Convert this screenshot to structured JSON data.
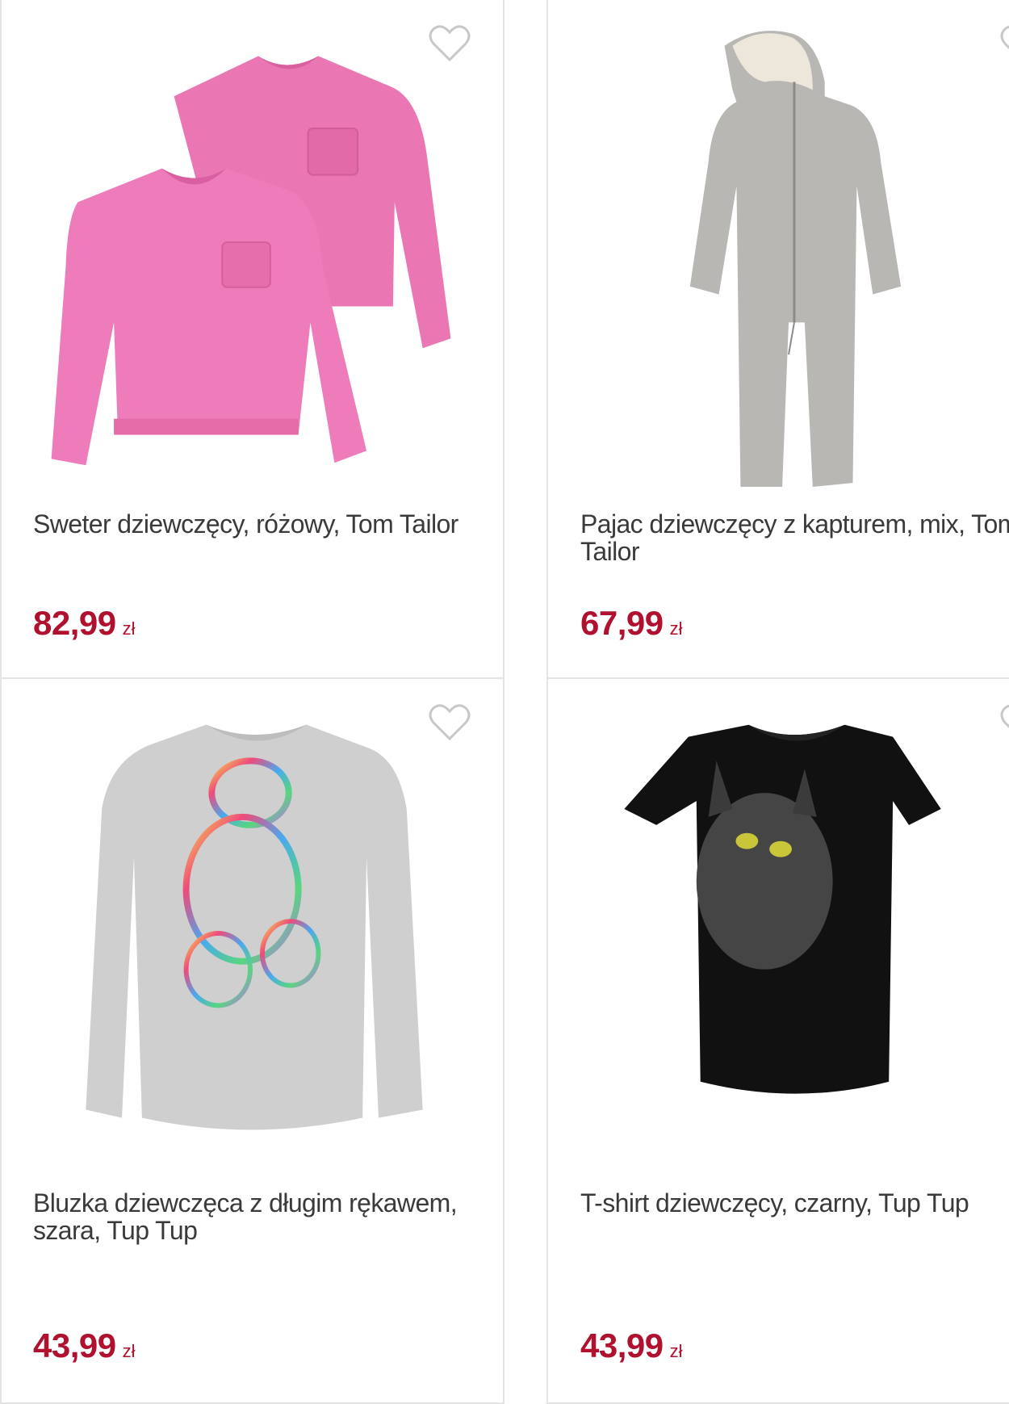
{
  "products": [
    {
      "title": "Sweter dziewczęcy, różowy, Tom Tailor",
      "price": "82,99",
      "currency": "zł",
      "image": "pink-sweaters-image"
    },
    {
      "title": "Pajac dziewczęcy z kapturem, mix, Tom Tailor",
      "price": "67,99",
      "currency": "zł",
      "image": "grey-onesie-image"
    },
    {
      "title": "Bluzka dziewczęca z długim rękawem, szara, Tup Tup",
      "price": "43,99",
      "currency": "zł",
      "image": "grey-longsleeve-bear-image"
    },
    {
      "title": "T-shirt dziewczęcy, czarny, Tup Tup",
      "price": "43,99",
      "currency": "zł",
      "image": "black-tshirt-cat-image"
    }
  ],
  "colors": {
    "price": "#b0112e",
    "title": "#3a3a3a",
    "border": "#e4e4e4",
    "heart": "#c8c8c8"
  }
}
